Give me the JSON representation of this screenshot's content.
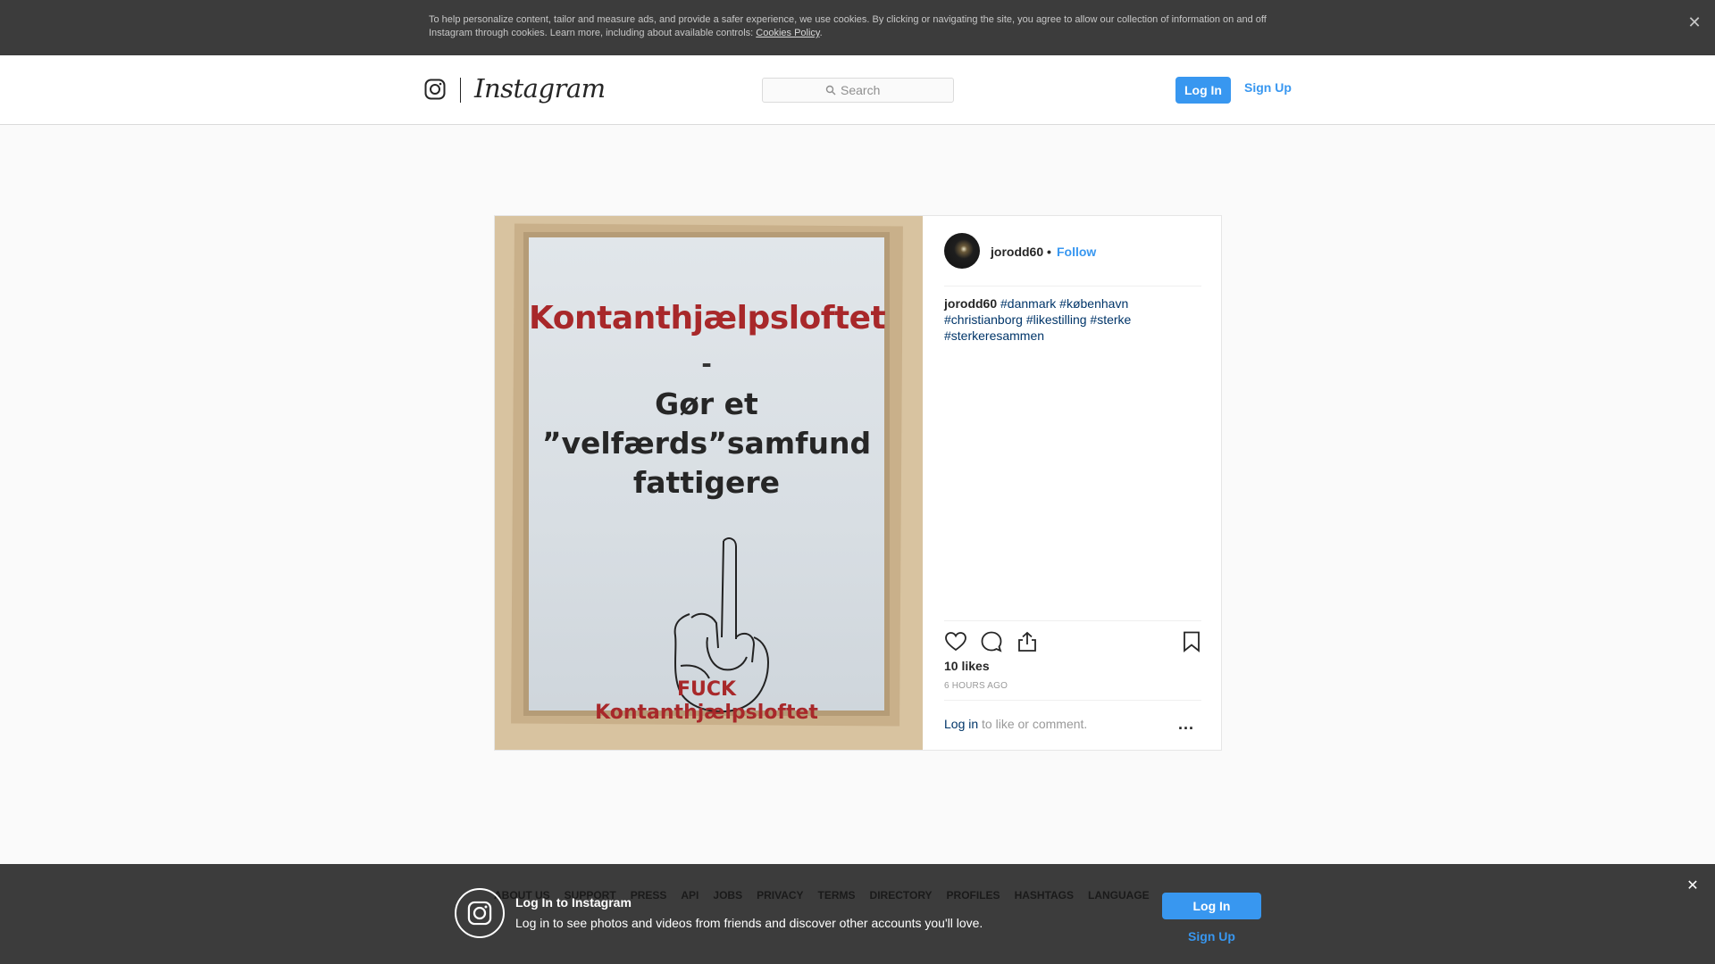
{
  "cookie_banner": {
    "text": "To help personalize content, tailor and measure ads, and provide a safer experience, we use cookies. By clicking or navigating the site, you agree to allow our collection of information on and off Instagram through cookies. Learn more, including about available controls: ",
    "link": "Cookies Policy",
    "suffix": ".",
    "close_icon": "close-icon"
  },
  "header": {
    "wordmark": "Instagram",
    "search_placeholder": "Search",
    "login_label": "Log In",
    "signup_label": "Sign Up"
  },
  "post": {
    "photo_text": {
      "title": "Kontanthjælpsloftet",
      "dash": "-",
      "line1": "Gør et",
      "line2": "”velfærds”samfund",
      "line3": "fattigere",
      "foot1": "FUCK",
      "foot2": "Kontanthjælpsloftet"
    },
    "author": "jorodd60",
    "separator": "•",
    "follow_label": "Follow",
    "caption_user": "jorodd60",
    "hashtags": [
      "#danmark",
      "#københavn",
      "#christianborg",
      "#likestilling",
      "#sterke",
      "#sterkeresammen"
    ],
    "likes": "10 likes",
    "time": "6 HOURS AGO",
    "login_link": "Log in",
    "comment_prompt": " to like or comment.",
    "more_label": "..."
  },
  "footer": {
    "links": [
      "About us",
      "Support",
      "Press",
      "API",
      "Jobs",
      "Privacy",
      "Terms",
      "Directory",
      "Profiles",
      "Hashtags",
      "Language"
    ]
  },
  "login_overlay": {
    "title": "Log In to Instagram",
    "subtitle": "Log in to see photos and videos from friends and discover other accounts you'll love.",
    "login_label": "Log In",
    "signup_label": "Sign Up"
  },
  "colors": {
    "accent": "#3897f0",
    "hashtag": "#003569",
    "banner": "#3c3c3c"
  }
}
